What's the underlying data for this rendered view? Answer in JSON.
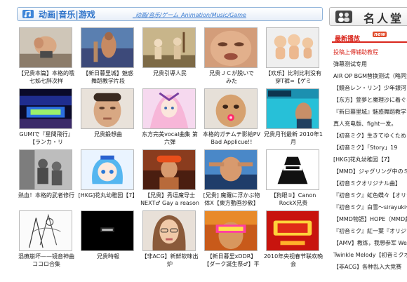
{
  "header": {
    "title": "动画|音乐|游戏",
    "subtitle": "_动画/音乐/ゲーム_Animation/Music/Game"
  },
  "videos": [
    {
      "caption": "【兄贵本篇】本格的哦\n七姊七胖次样"
    },
    {
      "caption": "【新日暮里城】魅惑\n舞蹈教学片段"
    },
    {
      "caption": "兄贵引導人民"
    },
    {
      "caption": "兄贵ＪＣが脱いで\nみた"
    },
    {
      "caption": "【欢乐】比利比利没有\n穿T裤=【ゲミ"
    },
    {
      "caption": "GUMIで『星間飛行』\n【ランカ・リ"
    },
    {
      "caption": "兄贵鍛想曲"
    },
    {
      "caption": "东方完美vocal曲集 第\n六弾"
    },
    {
      "caption": "本格的ガチムチ影絵PV\nBad Applicue!!"
    },
    {
      "caption": "兄贵月刊最新 2010年1\n月"
    },
    {
      "caption": "熱血！本格的武者修行"
    },
    {
      "caption": "[HKG]花丸幼稚园【7】"
    },
    {
      "caption": "【兄贵】秀逗魔导士\nNEXT♂ Gay a reason"
    },
    {
      "caption": "[兄贵] 魔羅に浮かぶ物\n体X【東方動画抄敎】"
    },
    {
      "caption": "【狗眼①】Canon\nRockX兄贵"
    },
    {
      "caption": "混療崩坏——镜音神曲\nココロ合集"
    },
    {
      "caption": "兄贵時報"
    },
    {
      "caption": "【非ACG】新鮮软味出\n炉"
    },
    {
      "caption": "【新日暮里xDDR】\n【ダーク誕生祭♂】平"
    },
    {
      "caption": "2010年央视春节联欢晚\n会"
    }
  ],
  "sidebar": {
    "title": "名人堂",
    "section_label": "最新播放",
    "new_badge": "new",
    "links": [
      {
        "text": "投稿上傳辅助教程",
        "red": true
      },
      {
        "text": "弹幕测试专用",
        "red": false
      },
      {
        "text": "AIR OP BGM替换测试（略同步",
        "red": false
      },
      {
        "text": "【鏡音レン・リン】少年銀河",
        "red": false
      },
      {
        "text": "【东方】萱夢と魔理沙に着ぐるみを",
        "red": false
      },
      {
        "text": "『新日暮里城』魅惑舞蹈教学",
        "red": false
      },
      {
        "text": "真人充电版、fight一发。",
        "red": false
      },
      {
        "text": "【初音ミク】生きてゆくために",
        "red": false
      },
      {
        "text": "【初音ミク】「Story」19",
        "red": false
      },
      {
        "text": "[HKG]花丸幼稚园【7】",
        "red": false
      },
      {
        "text": "【MMD】ジャグリング中のミク",
        "red": false
      },
      {
        "text": "【初音ミクオリジナル曲】",
        "red": false
      },
      {
        "text": "『初音ミク』虹色蝶々【オリジナル",
        "red": false
      },
      {
        "text": "『初音ミク』白雪～sirayuki～",
        "red": false
      },
      {
        "text": "【MMD物語】HOPE（MMD劇",
        "red": false
      },
      {
        "text": "『初音ミク』紅一葉『オリジナル",
        "red": false
      },
      {
        "text": "【AMV】教练，我想参军 We n",
        "red": false
      },
      {
        "text": "Twinkle Melody【初音ミクオ",
        "red": false
      },
      {
        "text": "【非ACG】各种乱入大竞赛",
        "red": false
      }
    ]
  }
}
